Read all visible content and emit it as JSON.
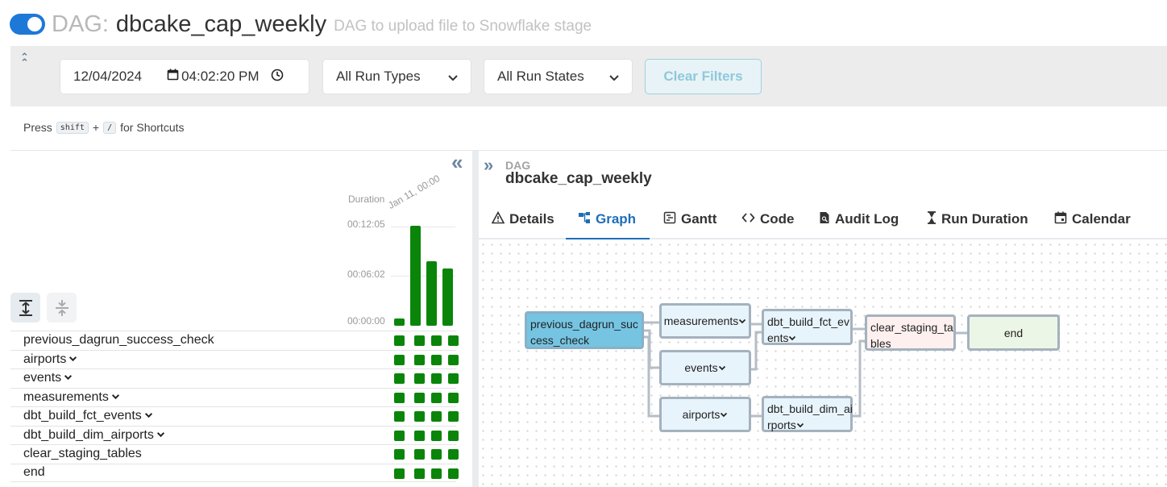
{
  "header": {
    "dag_prefix": "DAG:",
    "dag_id": "dbcake_cap_weekly",
    "description": "DAG to upload file to Snowflake stage",
    "toggle_state": "on"
  },
  "filters": {
    "date": "12/04/2024",
    "time": "04:02:20 PM",
    "run_types": "All Run Types",
    "run_states": "All Run States",
    "clear_label": "Clear Filters"
  },
  "shortcuts": {
    "press": "Press",
    "key1": "shift",
    "plus": "+",
    "key2": "/",
    "suffix": "for Shortcuts"
  },
  "grid": {
    "duration_label": "Duration",
    "run_date": "Jan 11, 00:00",
    "ticks": [
      "00:12:05",
      "00:06:02",
      "00:00:00"
    ],
    "runs_duration_fraction": [
      0.07,
      0.99,
      0.64,
      0.57
    ],
    "task_state_color": "#0a850a",
    "tasks": [
      {
        "name": "previous_dagrun_success_check",
        "group": false
      },
      {
        "name": "airports",
        "group": true
      },
      {
        "name": "events",
        "group": true
      },
      {
        "name": "measurements",
        "group": true
      },
      {
        "name": "dbt_build_fct_events",
        "group": true
      },
      {
        "name": "dbt_build_dim_airports",
        "group": true
      },
      {
        "name": "clear_staging_tables",
        "group": false
      },
      {
        "name": "end",
        "group": false
      }
    ]
  },
  "details": {
    "dag_small": "DAG",
    "dag_id": "dbcake_cap_weekly",
    "tabs": [
      {
        "label": "Details",
        "icon": "warning-triangle-icon"
      },
      {
        "label": "Graph",
        "icon": "graph-icon",
        "active": true
      },
      {
        "label": "Gantt",
        "icon": "gantt-icon"
      },
      {
        "label": "Code",
        "icon": "code-icon"
      },
      {
        "label": "Audit Log",
        "icon": "audit-log-icon"
      },
      {
        "label": "Run Duration",
        "icon": "hourglass-icon"
      },
      {
        "label": "Calendar",
        "icon": "calendar-icon"
      }
    ]
  },
  "graph": {
    "nodes": {
      "previous_check": {
        "l1": "previous_dagrun_suc",
        "l2": "cess_check"
      },
      "measurements": "measurements",
      "events": "events",
      "airports": "airports",
      "fct_events": {
        "l1": "dbt_build_fct_ev",
        "l2": "ents"
      },
      "dim_airports": {
        "l1": "dbt_build_dim_ai",
        "l2": "rports"
      },
      "clear_staging": {
        "l1": "clear_staging_ta",
        "l2": "bles"
      },
      "end": "end"
    }
  }
}
